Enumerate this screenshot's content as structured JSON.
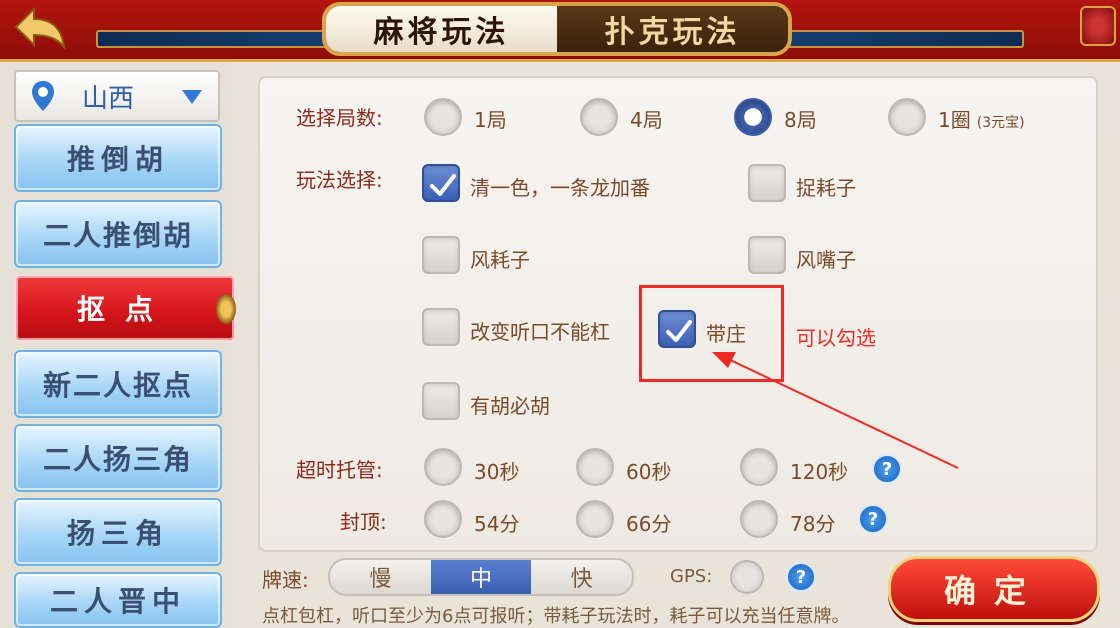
{
  "tabs": [
    {
      "label": "麻将玩法",
      "active": true
    },
    {
      "label": "扑克玩法",
      "active": false
    }
  ],
  "region": {
    "name": "山西"
  },
  "sidebar": {
    "items": [
      {
        "label": "推倒胡",
        "active": false
      },
      {
        "label": "二人推倒胡",
        "active": false
      },
      {
        "label": "抠点",
        "active": true
      },
      {
        "label": "新二人抠点",
        "active": false
      },
      {
        "label": "二人扬三角",
        "active": false
      },
      {
        "label": "扬三角",
        "active": false
      },
      {
        "label": "二人晋中",
        "active": false
      }
    ]
  },
  "rounds": {
    "label": "选择局数:",
    "options": [
      {
        "label": "1局",
        "checked": false
      },
      {
        "label": "4局",
        "checked": false
      },
      {
        "label": "8局",
        "checked": true
      },
      {
        "label": "1圈",
        "sub": "(3元宝)",
        "checked": false
      }
    ]
  },
  "play": {
    "label": "玩法选择:",
    "options": [
      {
        "label": "清一色，一条龙加番",
        "checked": true
      },
      {
        "label": "捉耗子",
        "checked": false
      },
      {
        "label": "风耗子",
        "checked": false
      },
      {
        "label": "风嘴子",
        "checked": false
      },
      {
        "label": "改变听口不能杠",
        "checked": false
      },
      {
        "label": "带庄",
        "checked": true
      },
      {
        "label": "有胡必胡",
        "checked": false
      }
    ]
  },
  "timeout": {
    "label": "超时托管:",
    "options": [
      {
        "label": "30秒",
        "checked": false
      },
      {
        "label": "60秒",
        "checked": false
      },
      {
        "label": "120秒",
        "checked": false
      }
    ]
  },
  "cap": {
    "label": "封顶:",
    "options": [
      {
        "label": "54分",
        "checked": false
      },
      {
        "label": "66分",
        "checked": false
      },
      {
        "label": "78分",
        "checked": false
      }
    ]
  },
  "speed": {
    "label": "牌速:",
    "options": [
      "慢",
      "中",
      "快"
    ],
    "selected": "中"
  },
  "gps": {
    "label": "GPS:",
    "enabled": false
  },
  "confirm": {
    "label": "确定"
  },
  "note": "点杠包杠，听口至少为6点可报听；带耗子玩法时，耗子可以充当任意牌。",
  "annotation": {
    "text": "可以勾选",
    "color": "#ef2a26"
  },
  "colors": {
    "accent_red": "#c0100c",
    "accent_blue": "#3f5fa7",
    "label_brown": "#8c2a1a"
  }
}
